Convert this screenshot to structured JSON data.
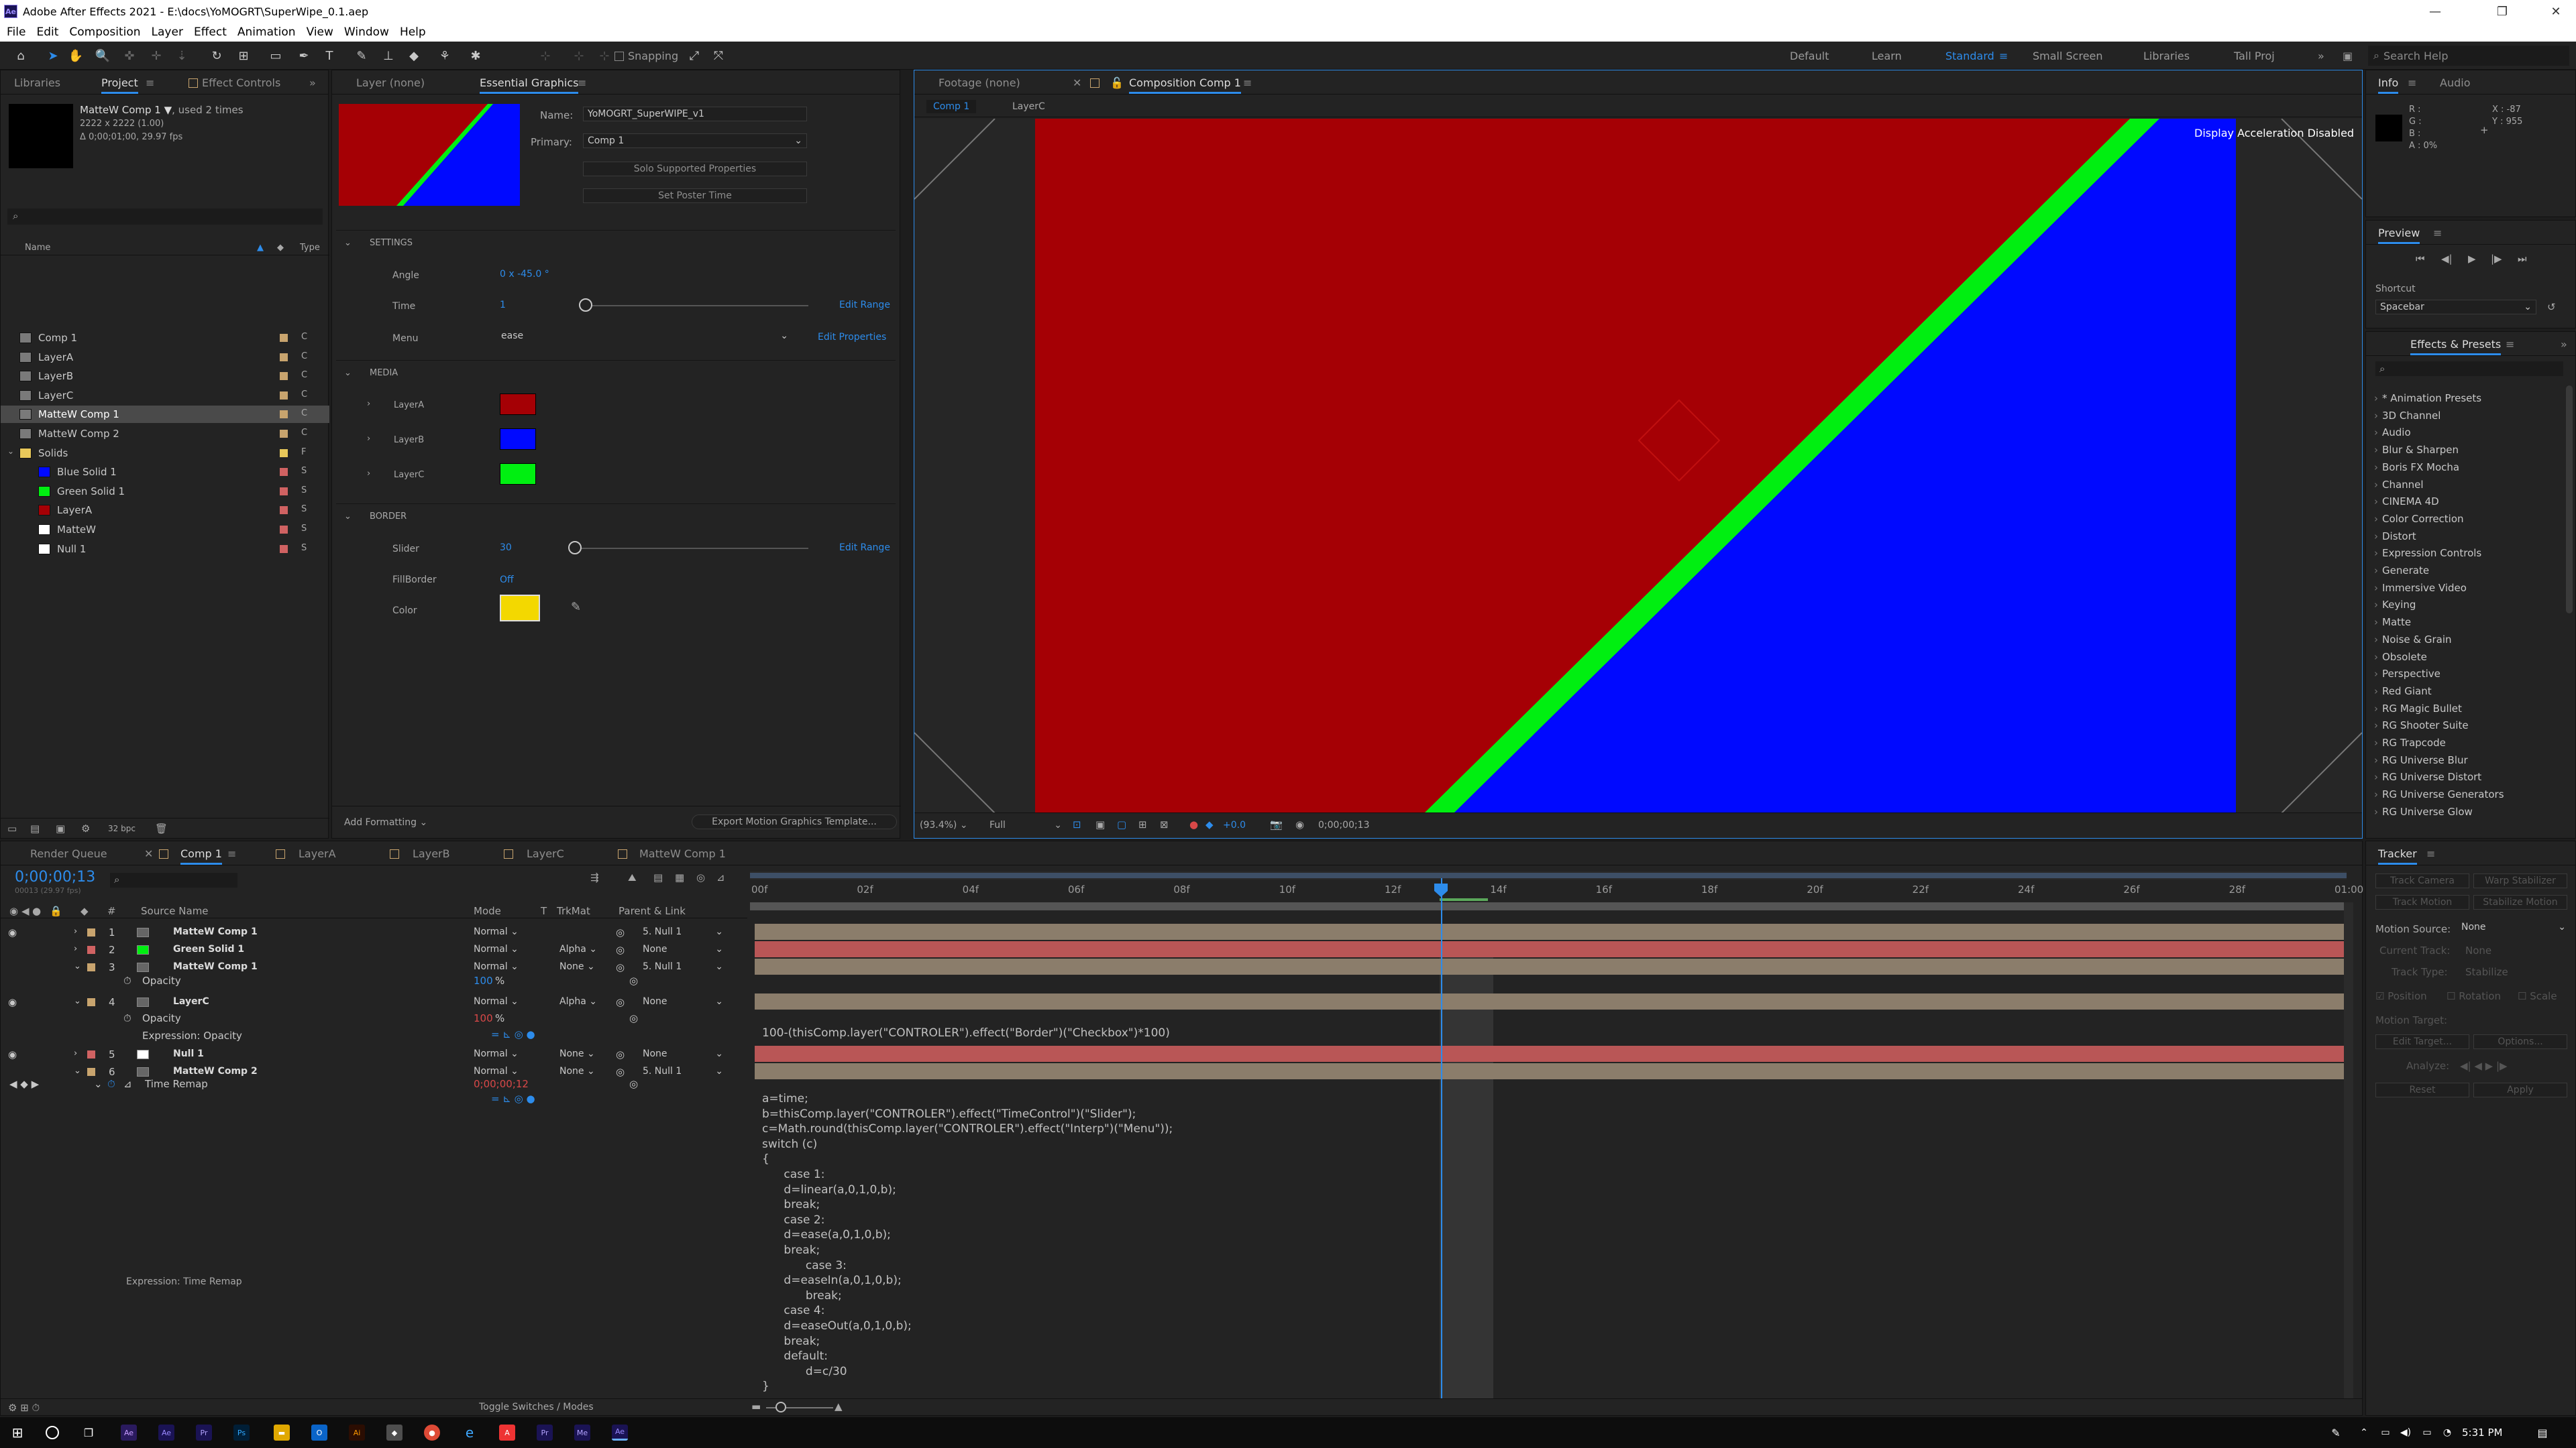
{
  "title": "Adobe After Effects 2021 - E:\\docs\\YoMOGRT\\SuperWipe_0.1.aep",
  "menu": [
    "File",
    "Edit",
    "Composition",
    "Layer",
    "Effect",
    "Animation",
    "View",
    "Window",
    "Help"
  ],
  "toolbar": {
    "snapping": "Snapping"
  },
  "workspaces": [
    "Default",
    "Learn",
    "Standard",
    "Small Screen",
    "Libraries",
    "Tall Proj"
  ],
  "search_help": "Search Help",
  "project": {
    "tabs": [
      "Libraries",
      "Project",
      "Effect Controls"
    ],
    "item_name": "MatteW Comp 1",
    "item_used": ", used 2 times",
    "item_dims": "2222 x 2222 (1.00)",
    "item_dur": "Δ 0;00;01;00, 29.97 fps",
    "col_name": "Name",
    "col_type": "Type",
    "bpc": "32 bpc",
    "items": [
      {
        "name": "Comp 1",
        "type": "C",
        "color": "#c8a46e"
      },
      {
        "name": "LayerA",
        "type": "C",
        "color": "#c8a46e"
      },
      {
        "name": "LayerB",
        "type": "C",
        "color": "#c8a46e"
      },
      {
        "name": "LayerC",
        "type": "C",
        "color": "#c8a46e"
      },
      {
        "name": "MatteW Comp 1",
        "type": "C",
        "color": "#c8a46e"
      },
      {
        "name": "MatteW Comp 2",
        "type": "C",
        "color": "#c8a46e"
      },
      {
        "name": "Solids",
        "type": "F",
        "color": "#e8c85a"
      },
      {
        "name": "Blue Solid 1",
        "type": "S",
        "color": "#d06262"
      },
      {
        "name": "Green Solid 1",
        "type": "S",
        "color": "#d06262"
      },
      {
        "name": "LayerA",
        "type": "S",
        "color": "#d06262"
      },
      {
        "name": "MatteW",
        "type": "S",
        "color": "#d06262"
      },
      {
        "name": "Null 1",
        "type": "S",
        "color": "#d06262"
      }
    ]
  },
  "eg": {
    "tabs": [
      "Layer  (none)",
      "Essential Graphics"
    ],
    "name_label": "Name:",
    "name_value": "YoMOGRT_SuperWIPE_v1",
    "primary_label": "Primary:",
    "primary_value": "Comp 1",
    "solo_btn": "Solo Supported Properties",
    "poster_btn": "Set Poster Time",
    "settings": "SETTINGS",
    "angle_label": "Angle",
    "angle_value": "0 x -45.0 °",
    "time_label": "Time",
    "time_value": "1",
    "edit_range": "Edit Range",
    "menu_label": "Menu",
    "menu_value": "ease",
    "edit_props": "Edit Properties",
    "media": "MEDIA",
    "layerA": "LayerA",
    "layerB": "LayerB",
    "layerC": "LayerC",
    "border": "BORDER",
    "slider_label": "Slider",
    "slider_value": "30",
    "fillborder_label": "FillBorder",
    "fillborder_value": "Off",
    "color_label": "Color",
    "add_formatting": "Add Formatting",
    "export_btn": "Export Motion Graphics Template..."
  },
  "viewer": {
    "tabs": [
      "Footage  (none)",
      "Composition  Comp 1"
    ],
    "crumbs": [
      "Comp 1",
      "LayerC"
    ],
    "display_msg": "Display Acceleration Disabled",
    "zoom": "(93.4%)",
    "res": "Full",
    "exposure": "+0.0",
    "timecode": "0;00;00;13"
  },
  "info": {
    "tabs": [
      "Info",
      "Audio"
    ],
    "rgb": "R :\nG :\nB :\nA : 0%",
    "xy": "X : -87\nY : 955"
  },
  "preview": {
    "title": "Preview",
    "shortcut_label": "Shortcut",
    "shortcut_value": "Spacebar"
  },
  "effects": {
    "title": "Effects & Presets",
    "items": [
      "* Animation Presets",
      "3D Channel",
      "Audio",
      "Blur & Sharpen",
      "Boris FX Mocha",
      "Channel",
      "CINEMA 4D",
      "Color Correction",
      "Distort",
      "Expression Controls",
      "Generate",
      "Immersive Video",
      "Keying",
      "Matte",
      "Noise & Grain",
      "Obsolete",
      "Perspective",
      "Red Giant",
      "RG Magic Bullet",
      "RG Shooter Suite",
      "RG Trapcode",
      "RG Universe Blur",
      "RG Universe Distort",
      "RG Universe Generators",
      "RG Universe Glow"
    ]
  },
  "timeline": {
    "render_queue": "Render Queue",
    "tabs": [
      "Comp 1",
      "LayerA",
      "LayerB",
      "LayerC",
      "MatteW Comp 1"
    ],
    "timecode": "0;00;00;13",
    "timecode_sub": "00013 (29.97 fps)",
    "cols": {
      "source": "Source Name",
      "mode": "Mode",
      "t": "T",
      "trkmat": "TrkMat",
      "parent": "Parent & Link"
    },
    "layers": [
      {
        "num": "1",
        "name": "MatteW Comp 1",
        "mode": "Normal",
        "trk": "",
        "parent": "5. Null 1",
        "label": "#c8a46e"
      },
      {
        "num": "2",
        "name": "Green Solid 1",
        "mode": "Normal",
        "trk": "Alpha",
        "parent": "None",
        "label": "#d06262"
      },
      {
        "num": "3",
        "name": "MatteW Comp 1",
        "mode": "Normal",
        "trk": "None",
        "parent": "5. Null 1",
        "label": "#c8a46e"
      },
      {
        "num": "4",
        "name": "LayerC",
        "mode": "Normal",
        "trk": "Alpha",
        "parent": "None",
        "label": "#c8a46e"
      },
      {
        "num": "5",
        "name": "Null 1",
        "mode": "Normal",
        "trk": "None",
        "parent": "None",
        "label": "#d06262"
      },
      {
        "num": "6",
        "name": "MatteW Comp 2",
        "mode": "Normal",
        "trk": "None",
        "parent": "5. Null 1",
        "label": "#c8a46e"
      }
    ],
    "opacity": "Opacity",
    "opacity_val1": "100",
    "opacity_val2": "100",
    "pct": "%",
    "expr_opacity": "Expression: Opacity",
    "time_remap": "Time Remap",
    "time_remap_val": "0;00;00;12",
    "expr_time_remap": "Expression: Time Remap",
    "ticks": [
      "00f",
      "02f",
      "04f",
      "06f",
      "08f",
      "10f",
      "12f",
      "14f",
      "16f",
      "18f",
      "20f",
      "22f",
      "24f",
      "26f",
      "28f",
      "01:00"
    ],
    "expr1": "100-(thisComp.layer(\"CONTROLER\").effect(\"Border\")(\"Checkbox\")*100)",
    "expr2": "a=time;\nb=thisComp.layer(\"CONTROLER\").effect(\"TimeControl\")(\"Slider\");\nc=Math.round(thisComp.layer(\"CONTROLER\").effect(\"Interp\")(\"Menu\"));\nswitch (c)\n{\n      case 1:\n      d=linear(a,0,1,0,b);\n      break;\n      case 2:\n      d=ease(a,0,1,0,b);\n      break;\n            case 3:\n      d=easeIn(a,0,1,0,b);\n            break;\n      case 4:\n      d=easeOut(a,0,1,0,b);\n      break;\n      default:\n            d=c/30\n}",
    "toggle": "Toggle Switches / Modes"
  },
  "tracker": {
    "title": "Tracker",
    "track_camera": "Track Camera",
    "warp_stab": "Warp Stabilizer",
    "track_motion": "Track Motion",
    "stab_motion": "Stabilize Motion",
    "motion_source_label": "Motion Source:",
    "motion_source_value": "None",
    "current_track": "Current Track:",
    "current_track_value": "None",
    "track_type": "Track Type:",
    "track_type_value": "Stabilize",
    "position": "Position",
    "rotation": "Rotation",
    "scale": "Scale",
    "motion_target": "Motion Target:",
    "edit_target": "Edit Target...",
    "options": "Options...",
    "analyze": "Analyze:",
    "reset": "Reset",
    "apply": "Apply"
  },
  "taskbar": {
    "time": "5:31 PM"
  }
}
